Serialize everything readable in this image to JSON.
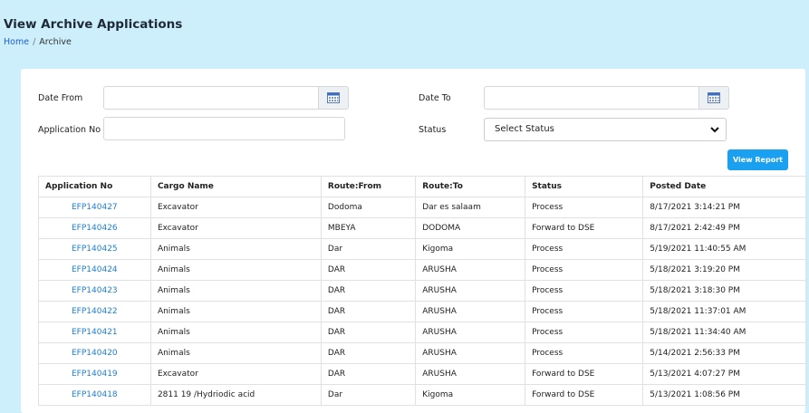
{
  "header": {
    "title": "View Archive Applications",
    "breadcrumb": {
      "home": "Home",
      "separator": "/",
      "current": "Archive"
    }
  },
  "filters": {
    "date_from_label": "Date From",
    "date_to_label": "Date To",
    "application_no_label": "Application No",
    "status_label": "Status",
    "status_value": "Select Status",
    "date_from_value": "",
    "date_to_value": "",
    "application_no_value": "",
    "view_report_label": "View Report"
  },
  "table": {
    "columns": [
      "Application No",
      "Cargo Name",
      "Route:From",
      "Route:To",
      "Status",
      "Posted Date"
    ],
    "rows": [
      [
        "EFP140427",
        "Excavator",
        "Dodoma",
        "Dar es salaam",
        "Process",
        "8/17/2021 3:14:21 PM"
      ],
      [
        "EFP140426",
        "Excavator",
        "MBEYA",
        "DODOMA",
        "Forward to DSE",
        "8/17/2021 2:42:49 PM"
      ],
      [
        "EFP140425",
        "Animals",
        "Dar",
        "Kigoma",
        "Process",
        "5/19/2021 11:40:55 AM"
      ],
      [
        "EFP140424",
        "Animals",
        "DAR",
        "ARUSHA",
        "Process",
        "5/18/2021 3:19:20 PM"
      ],
      [
        "EFP140423",
        "Animals",
        "DAR",
        "ARUSHA",
        "Process",
        "5/18/2021 3:18:30 PM"
      ],
      [
        "EFP140422",
        "Animals",
        "DAR",
        "ARUSHA",
        "Process",
        "5/18/2021 11:37:01 AM"
      ],
      [
        "EFP140421",
        "Animals",
        "DAR",
        "ARUSHA",
        "Process",
        "5/18/2021 11:34:40 AM"
      ],
      [
        "EFP140420",
        "Animals",
        "DAR",
        "ARUSHA",
        "Process",
        "5/14/2021 2:56:33 PM"
      ],
      [
        "EFP140419",
        "Excavator",
        "DAR",
        "ARUSHA",
        "Forward to DSE",
        "5/13/2021 4:07:27 PM"
      ],
      [
        "EFP140418",
        "2811 19 /Hydriodic acid",
        "Dar",
        "Kigoma",
        "Forward to DSE",
        "5/13/2021 1:08:56 PM"
      ]
    ]
  },
  "colors": {
    "page_bg": "#cdeefb",
    "accent": "#1aa0f0",
    "link": "#1d7fd1"
  },
  "icons": {
    "calendar": "calendar-icon",
    "chevron": "chevron-down-icon"
  }
}
